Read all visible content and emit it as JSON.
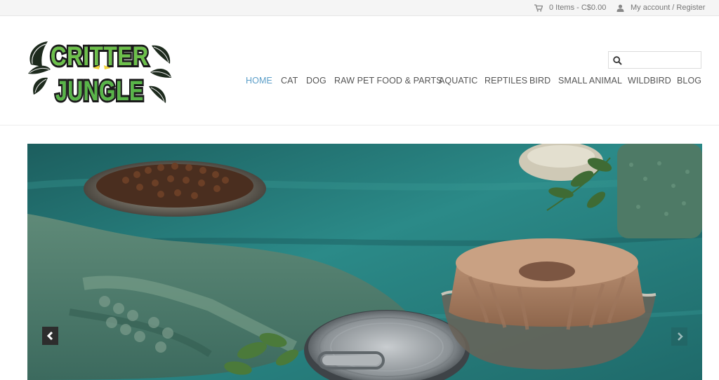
{
  "topbar": {
    "cart_text": "0 Items - C$0.00",
    "account_text": "My account / Register"
  },
  "brand": {
    "logo_line1": "CRITTER",
    "logo_line2": "JUNGLE",
    "accent_color": "#5b9ec8"
  },
  "search": {
    "value": "",
    "placeholder": ""
  },
  "nav": {
    "items": [
      {
        "label": "HOME",
        "active": true
      },
      {
        "label": "CAT"
      },
      {
        "label": "DOG"
      },
      {
        "label": "RAW PET FOOD & PARTS"
      },
      {
        "label": "AQUATIC"
      },
      {
        "label": "REPTILES"
      },
      {
        "label": "BIRD"
      },
      {
        "label": "SMALL ANIMAL"
      },
      {
        "label": "WILDBIRD"
      },
      {
        "label": "BLOG"
      }
    ]
  },
  "hero": {
    "prev_icon": "chevron-left-icon",
    "next_icon": "chevron-right-icon"
  }
}
